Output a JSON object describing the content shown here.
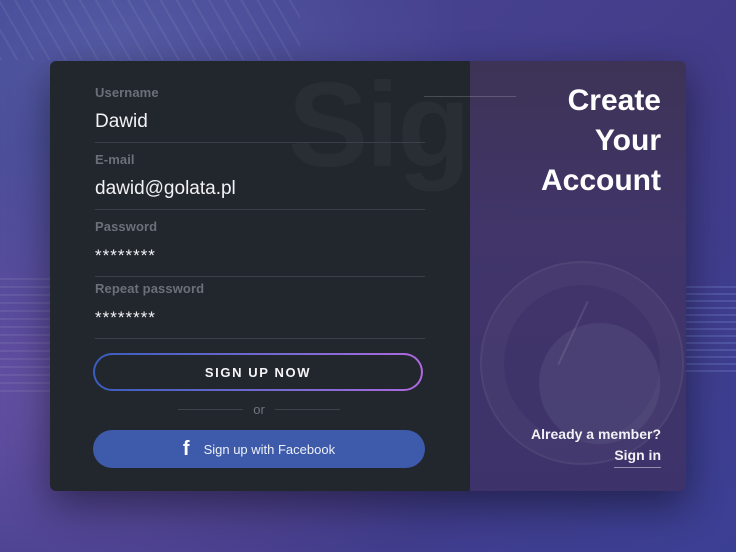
{
  "form": {
    "watermark": "Sign",
    "fields": [
      {
        "label": "Username",
        "value": "Dawid"
      },
      {
        "label": "E-mail",
        "value": "dawid@golata.pl"
      },
      {
        "label": "Password",
        "value": "********"
      },
      {
        "label": "Repeat password",
        "value": "********"
      }
    ],
    "signup_button": "SIGN UP NOW",
    "or_text": "or",
    "facebook_icon": "f",
    "facebook_button": "Sign up with Facebook"
  },
  "side": {
    "headline": [
      "Create",
      "Your",
      "Account"
    ],
    "member_question": "Already a member?",
    "signin_link": "Sign in"
  },
  "colors": {
    "background": "#433c89",
    "form_panel": "#22262d",
    "side_panel": "#3f3465",
    "facebook": "#3d5aab",
    "gradient_start": "#3a5dbd",
    "gradient_end": "#b068e0"
  },
  "icons": {
    "facebook": "facebook-icon"
  }
}
